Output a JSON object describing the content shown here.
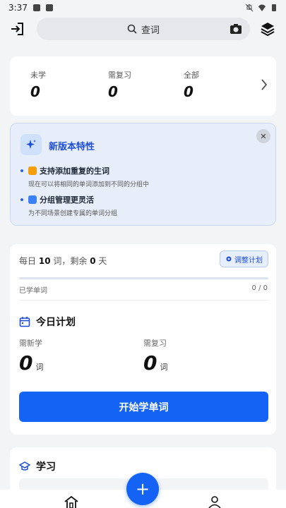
{
  "status_bar": {
    "time": "3:37"
  },
  "search": {
    "placeholder": "查词"
  },
  "stats": [
    {
      "label": "未学",
      "value": "0"
    },
    {
      "label": "需复习",
      "value": "0"
    },
    {
      "label": "全部",
      "value": "0"
    }
  ],
  "feature": {
    "title": "新版本特性",
    "items": [
      {
        "title": "支持添加重复的生词",
        "desc": "现在可以将相同的单词添加到不同的分组中"
      },
      {
        "title": "分组管理更灵活",
        "desc": "为不同场景创建专属的单词分组"
      }
    ]
  },
  "plan": {
    "daily_prefix": "每日",
    "daily_count": "10",
    "daily_mid": "词，剩余",
    "days_left": "0",
    "daily_suffix": "天",
    "adjust_label": "调整计划",
    "progress": 0,
    "learned_label": "已学单词",
    "learned_value": "0 / 0",
    "today_title": "今日计划",
    "new_label": "需新学",
    "new_value": "0",
    "review_label": "需复习",
    "review_value": "0",
    "unit": "词",
    "start_label": "开始学单词"
  },
  "learn": {
    "title": "学习"
  },
  "colors": {
    "accent": "#1563f4",
    "feature_bg": "#e8eef9"
  },
  "icons": [
    "login-icon",
    "search-icon",
    "camera-icon",
    "layers-icon",
    "chevron-right-icon",
    "sparkle-icon",
    "close-icon",
    "gear-icon",
    "calendar-icon",
    "graduation-cap-icon",
    "home-icon",
    "plus-icon",
    "profile-icon"
  ]
}
